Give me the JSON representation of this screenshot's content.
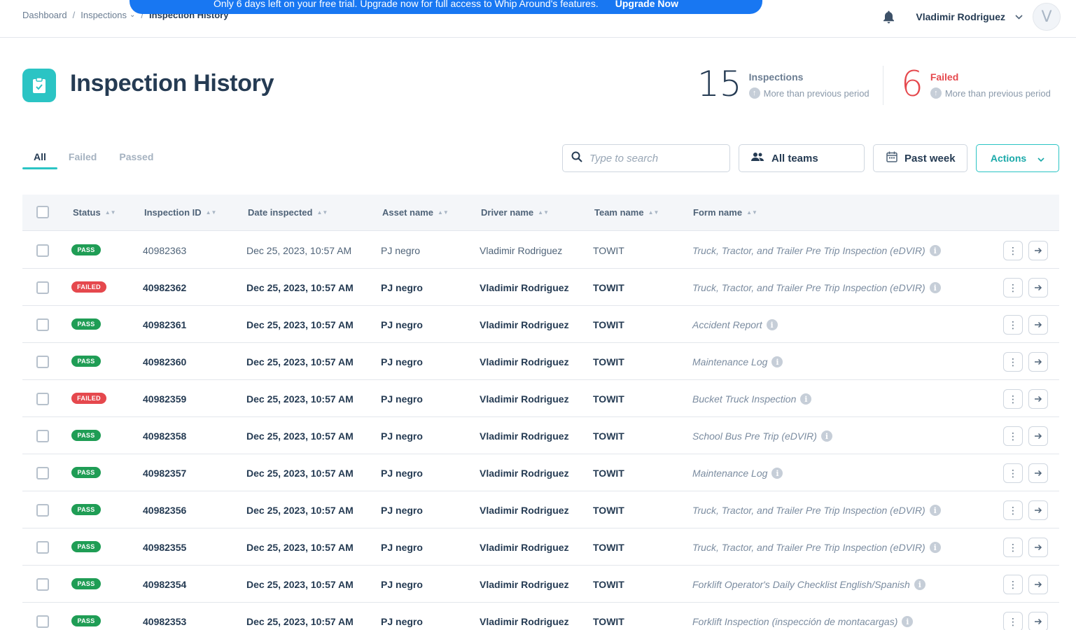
{
  "topbar": {
    "breadcrumb": [
      "Dashboard",
      "Inspections",
      "Inspection History"
    ],
    "banner_text": "Only 6 days left on your free trial. Upgrade now for full access to Whip Around's features.",
    "banner_link": "Upgrade Now",
    "user_name": "Vladimir Rodriguez",
    "avatar_initial": "V"
  },
  "header": {
    "title": "Inspection History",
    "stats": [
      {
        "value": "15",
        "label": "Inspections",
        "sub": "More than previous period"
      },
      {
        "value": "6",
        "label": "Failed",
        "sub": "More than previous period"
      }
    ]
  },
  "tabs": [
    "All",
    "Failed",
    "Passed"
  ],
  "filters": {
    "search_placeholder": "Type to search",
    "teams": "All teams",
    "period": "Past week",
    "actions": "Actions"
  },
  "table": {
    "headers": [
      "Status",
      "Inspection ID",
      "Date inspected",
      "Asset name",
      "Driver name",
      "Team name",
      "Form name"
    ],
    "rows": [
      {
        "status": "PASS",
        "id": "40982363",
        "date": "Dec 25, 2023, 10:57 AM",
        "asset": "PJ negro",
        "driver": "Vladimir Rodriguez",
        "team": "TOWIT",
        "form": "Truck, Tractor, and Trailer Pre Trip Inspection (eDVIR)"
      },
      {
        "status": "FAILED",
        "id": "40982362",
        "date": "Dec 25, 2023, 10:57 AM",
        "asset": "PJ negro",
        "driver": "Vladimir Rodriguez",
        "team": "TOWIT",
        "form": "Truck, Tractor, and Trailer Pre Trip Inspection (eDVIR)"
      },
      {
        "status": "PASS",
        "id": "40982361",
        "date": "Dec 25, 2023, 10:57 AM",
        "asset": "PJ negro",
        "driver": "Vladimir Rodriguez",
        "team": "TOWIT",
        "form": "Accident Report"
      },
      {
        "status": "PASS",
        "id": "40982360",
        "date": "Dec 25, 2023, 10:57 AM",
        "asset": "PJ negro",
        "driver": "Vladimir Rodriguez",
        "team": "TOWIT",
        "form": "Maintenance Log"
      },
      {
        "status": "FAILED",
        "id": "40982359",
        "date": "Dec 25, 2023, 10:57 AM",
        "asset": "PJ negro",
        "driver": "Vladimir Rodriguez",
        "team": "TOWIT",
        "form": "Bucket Truck Inspection"
      },
      {
        "status": "PASS",
        "id": "40982358",
        "date": "Dec 25, 2023, 10:57 AM",
        "asset": "PJ negro",
        "driver": "Vladimir Rodriguez",
        "team": "TOWIT",
        "form": "School Bus Pre Trip (eDVIR)"
      },
      {
        "status": "PASS",
        "id": "40982357",
        "date": "Dec 25, 2023, 10:57 AM",
        "asset": "PJ negro",
        "driver": "Vladimir Rodriguez",
        "team": "TOWIT",
        "form": "Maintenance Log"
      },
      {
        "status": "PASS",
        "id": "40982356",
        "date": "Dec 25, 2023, 10:57 AM",
        "asset": "PJ negro",
        "driver": "Vladimir Rodriguez",
        "team": "TOWIT",
        "form": "Truck, Tractor, and Trailer Pre Trip Inspection (eDVIR)"
      },
      {
        "status": "PASS",
        "id": "40982355",
        "date": "Dec 25, 2023, 10:57 AM",
        "asset": "PJ negro",
        "driver": "Vladimir Rodriguez",
        "team": "TOWIT",
        "form": "Truck, Tractor, and Trailer Pre Trip Inspection (eDVIR)"
      },
      {
        "status": "PASS",
        "id": "40982354",
        "date": "Dec 25, 2023, 10:57 AM",
        "asset": "PJ negro",
        "driver": "Vladimir Rodriguez",
        "team": "TOWIT",
        "form": "Forklift Operator's Daily Checklist English/Spanish"
      },
      {
        "status": "PASS",
        "id": "40982353",
        "date": "Dec 25, 2023, 10:57 AM",
        "asset": "PJ negro",
        "driver": "Vladimir Rodriguez",
        "team": "TOWIT",
        "form": "Forklift Inspection (inspección de montacargas)"
      }
    ]
  },
  "colors": {
    "accent": "#2bc4c4",
    "pass": "#1f9d55",
    "failed": "#e5484d",
    "banner": "#1877f2"
  },
  "icons": [
    "bell-icon",
    "clipboard-check-icon",
    "search-icon",
    "team-icon",
    "calendar-icon",
    "chevron-down-icon",
    "info-icon",
    "more-icon",
    "arrow-right-icon"
  ]
}
